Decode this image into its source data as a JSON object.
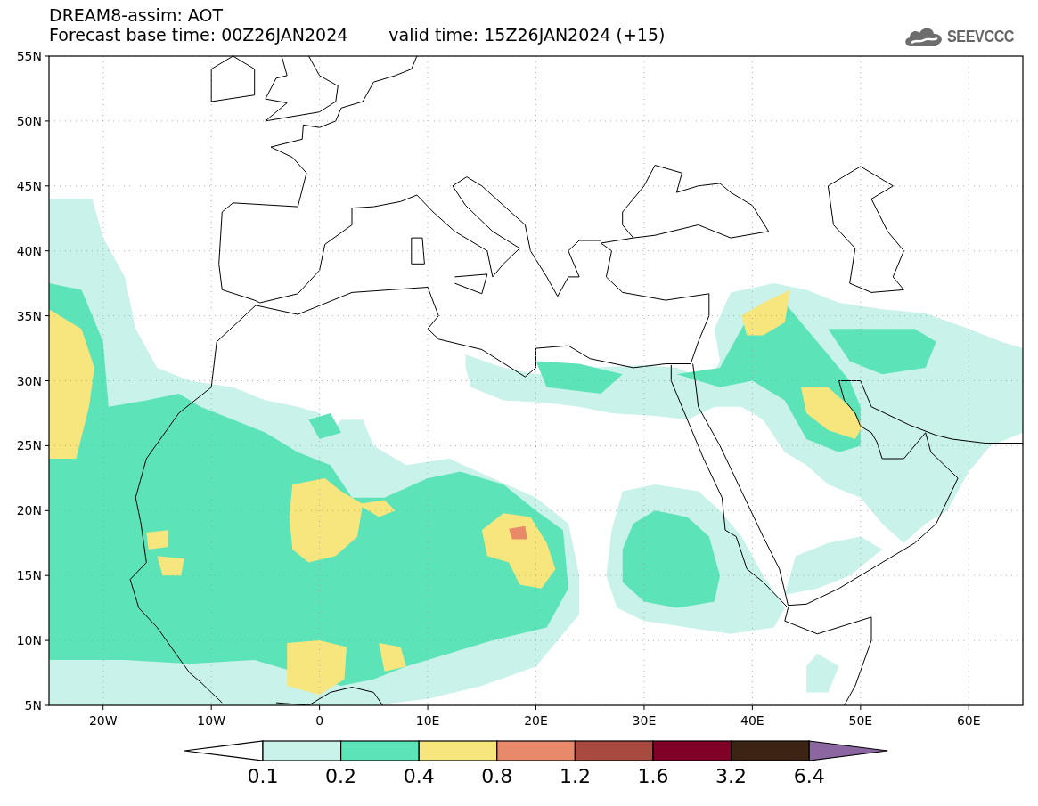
{
  "header": {
    "title": "DREAM8-assim: AOT",
    "base_time": "Forecast base time: 00Z26JAN2024",
    "valid_time": "valid time: 15Z26JAN2024 (+15)",
    "logo": "SEEVCCC"
  },
  "map": {
    "lat_labels": [
      "55N",
      "50N",
      "45N",
      "40N",
      "35N",
      "30N",
      "25N",
      "20N",
      "15N",
      "10N",
      "5N"
    ],
    "lon_labels": [
      "20W",
      "10W",
      "0",
      "10E",
      "20E",
      "30E",
      "40E",
      "50E",
      "60E"
    ]
  },
  "colorbar": {
    "segments": [
      {
        "kind": "arrow-left",
        "color": "#ffffff"
      },
      {
        "kind": "box",
        "color": "#c8f2ea"
      },
      {
        "kind": "box",
        "color": "#5de3b8"
      },
      {
        "kind": "box",
        "color": "#f7e67e"
      },
      {
        "kind": "box",
        "color": "#e88a6a"
      },
      {
        "kind": "box",
        "color": "#a84a40"
      },
      {
        "kind": "box",
        "color": "#800028"
      },
      {
        "kind": "box",
        "color": "#3c2414"
      },
      {
        "kind": "arrow-right",
        "color": "#8c66a0"
      }
    ],
    "labels": [
      "0.1",
      "0.2",
      "0.4",
      "0.8",
      "1.2",
      "1.6",
      "3.2",
      "6.4"
    ]
  }
}
